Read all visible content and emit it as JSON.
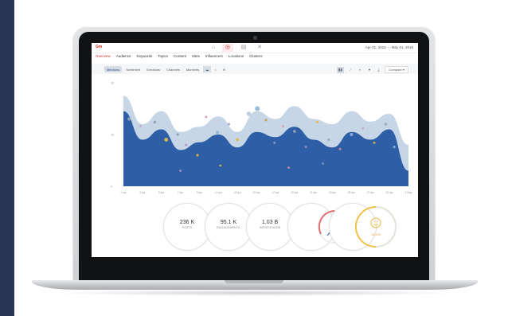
{
  "app": {
    "brand": "Gm",
    "date_range": "Apr 01, 2016",
    "date_sep": " — ",
    "date_end": "May 01, 2016",
    "toolbar_icons": [
      "home-icon",
      "target-icon",
      "document-icon",
      "tools-icon"
    ],
    "active_toolbar_icon": 1
  },
  "nav": {
    "tabs": [
      "Overview",
      "Audience",
      "Keywords",
      "Topics",
      "Content",
      "Sites",
      "Influencers",
      "Locations",
      "Clusters"
    ],
    "active": 0
  },
  "subbar": {
    "pills": [
      "Mentions",
      "Sentiment",
      "Emotions",
      "Channels",
      "Moments"
    ],
    "active": 0,
    "compare_label": "Compare"
  },
  "chart_data": {
    "type": "area",
    "x": [
      "1 Apr",
      "3 Apr",
      "5 Apr",
      "7 Apr",
      "9 Apr",
      "11 Apr",
      "13 Apr",
      "15 Apr",
      "17 Apr",
      "19 Apr",
      "21 Apr",
      "23 Apr",
      "25 Apr",
      "27 Apr",
      "29 Apr",
      "1 May"
    ],
    "ylim": [
      0,
      2000
    ],
    "y_ticks_left": [
      "2K",
      "1K",
      "0"
    ],
    "series": [
      {
        "values": [
          1750,
          1200,
          1450,
          1050,
          1150,
          1350,
          1050,
          1450,
          1300,
          1550,
          1300,
          1200,
          1450,
          1250,
          1400,
          800
        ],
        "color": "#c7d6e6"
      },
      {
        "values": [
          1450,
          900,
          1100,
          700,
          850,
          1000,
          750,
          1050,
          950,
          1150,
          900,
          750,
          1050,
          900,
          1100,
          300
        ],
        "color": "#2d5ea6"
      }
    ],
    "colors": {
      "light": "#c7d6e6",
      "dark": "#2d5ea6",
      "accent": "#e0b84a"
    }
  },
  "stats": [
    {
      "value": "236 K",
      "label": "POSTS"
    },
    {
      "value": "95.1 K",
      "label": "ENGAGEMENTS"
    },
    {
      "value": "1.03 B",
      "label": "IMPRESSIONS"
    }
  ],
  "gauge": {
    "value": "20"
  },
  "sentiment": {
    "value": "26.4%"
  }
}
